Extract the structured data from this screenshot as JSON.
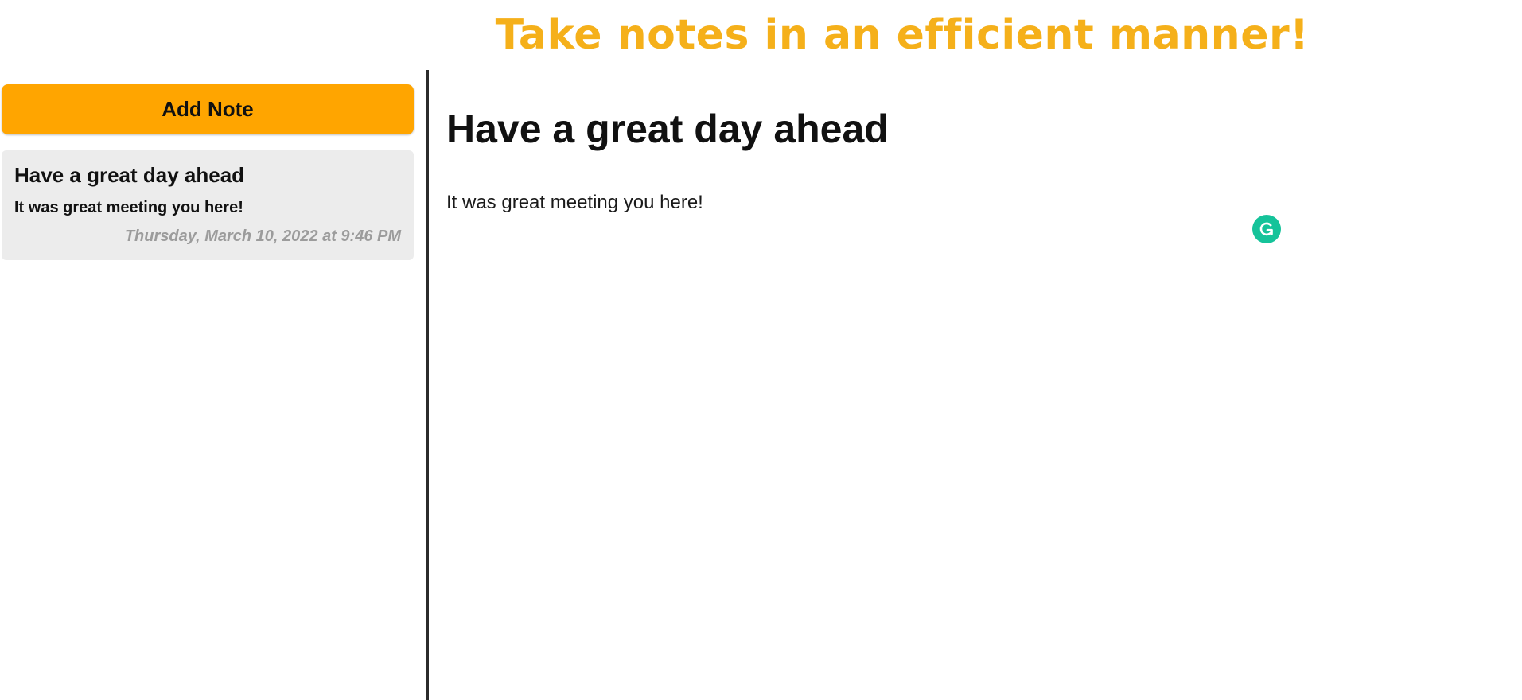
{
  "header": {
    "title": "Take notes in an efficient manner!"
  },
  "sidebar": {
    "add_note_label": "Add Note",
    "notes": [
      {
        "title": "Have a great day ahead",
        "preview": "It was great meeting you here!",
        "modified": "Thursday, March 10, 2022 at 9:46 PM"
      }
    ]
  },
  "main": {
    "note_title": "Have a great day ahead",
    "note_body": "It was great meeting you here!"
  },
  "icons": {
    "grammarly": "grammarly-icon"
  },
  "colors": {
    "title_accent": "#f5b01a",
    "button_bg": "#ffa500",
    "card_bg": "#ececec",
    "meta_text": "#9c9c9c",
    "grammarly_green": "#15c39a"
  }
}
